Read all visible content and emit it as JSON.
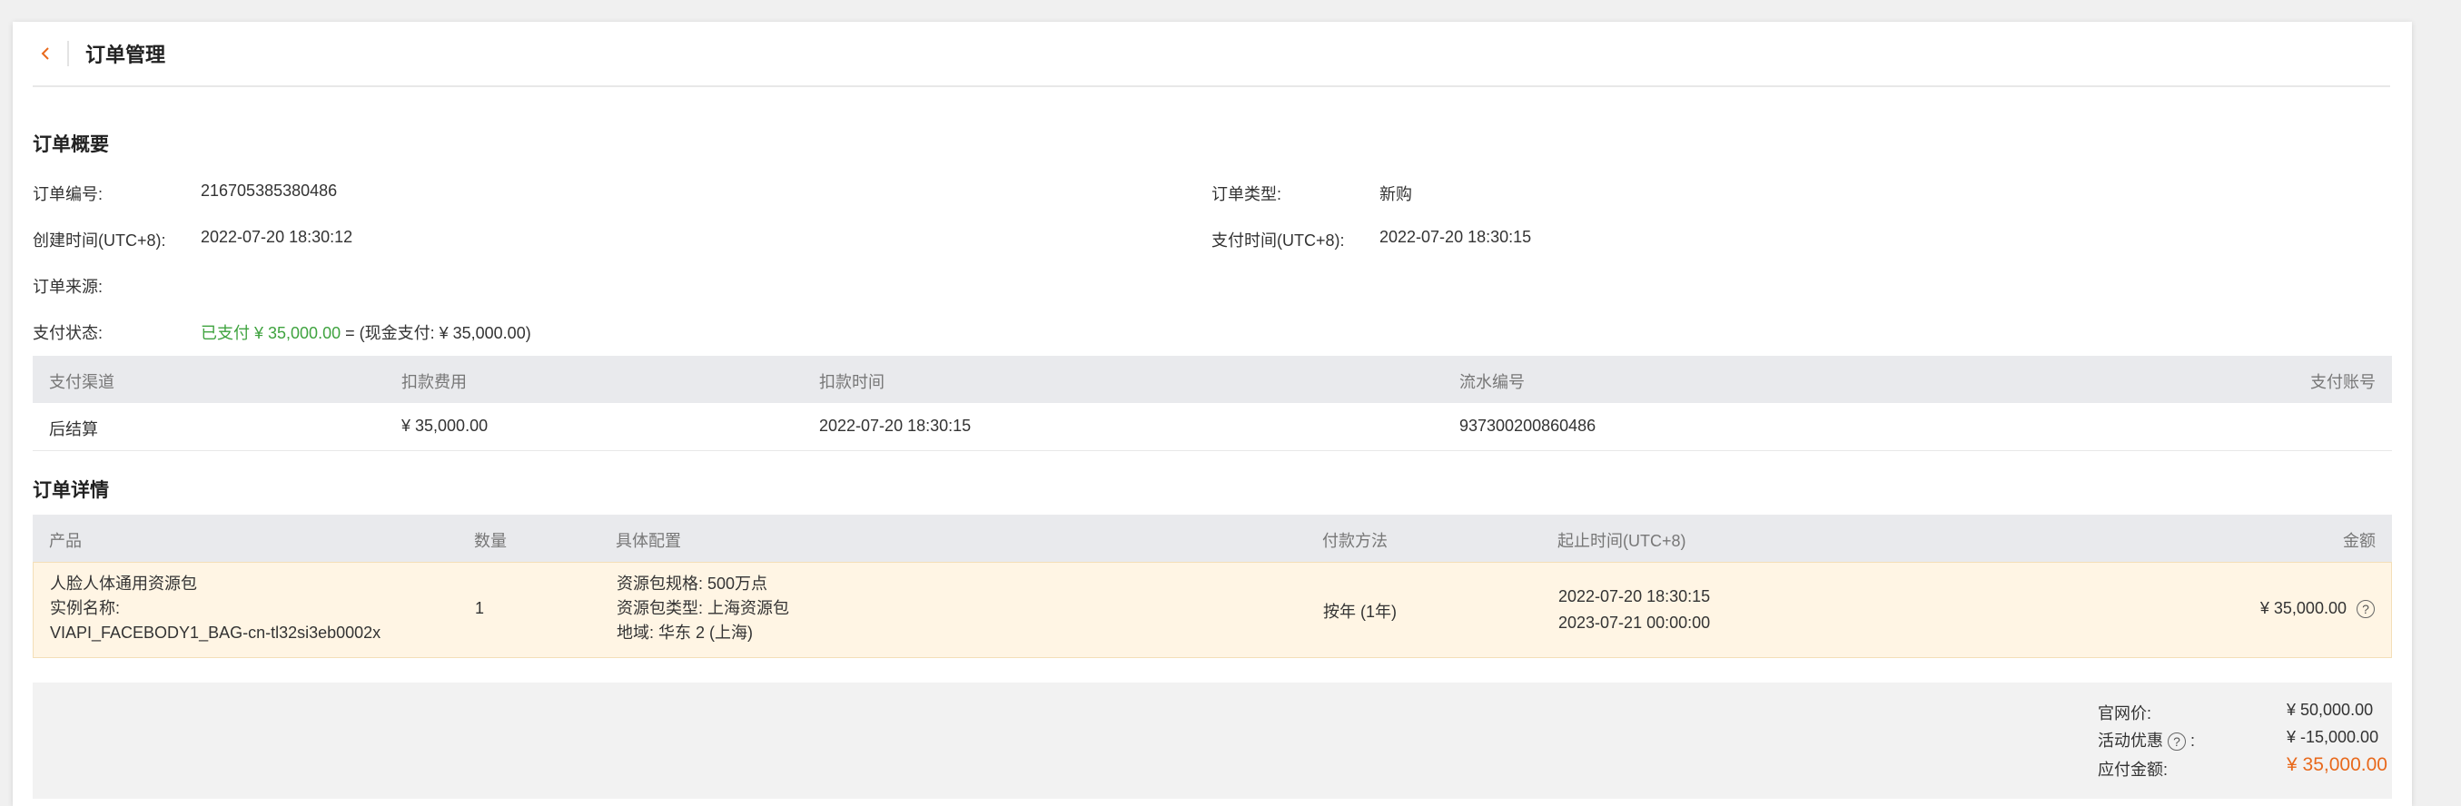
{
  "header": {
    "title": "订单管理"
  },
  "overview": {
    "title": "订单概要",
    "order_no_label": "订单编号:",
    "order_no": "216705385380486",
    "order_type_label": "订单类型:",
    "order_type": "新购",
    "created_label": "创建时间(UTC+8):",
    "created": "2022-07-20 18:30:12",
    "paid_label": "支付时间(UTC+8):",
    "paid": "2022-07-20 18:30:15",
    "source_label": "订单来源:",
    "source": "",
    "status_label": "支付状态:",
    "status_paid": "已支付 ¥ 35,000.00",
    "status_detail": "= (现金支付: ¥ 35,000.00)"
  },
  "payment_table": {
    "headers": [
      "支付渠道",
      "扣款费用",
      "扣款时间",
      "流水编号",
      "支付账号"
    ],
    "rows": [
      [
        "后结算",
        "¥ 35,000.00",
        "2022-07-20 18:30:15",
        "937300200860486",
        ""
      ]
    ]
  },
  "details": {
    "title": "订单详情",
    "headers": [
      "产品",
      "数量",
      "具体配置",
      "付款方法",
      "起止时间(UTC+8)",
      "金额"
    ],
    "row": {
      "product_name": "人脸人体通用资源包",
      "instance_label": "实例名称:",
      "instance_id": "VIAPI_FACEBODY1_BAG-cn-tl32si3eb0002x",
      "quantity": "1",
      "config": [
        "资源包规格: 500万点",
        "资源包类型: 上海资源包",
        "地域: 华东 2 (上海)"
      ],
      "pay_method": "按年 (1年)",
      "start": "2022-07-20 18:30:15",
      "end": "2023-07-21 00:00:00",
      "amount": "¥ 35,000.00"
    }
  },
  "summary": {
    "list_price_label": "官网价:",
    "list_price": "¥ 50,000.00",
    "discount_label": "活动优惠",
    "discount_colon": ":",
    "discount": "¥ -15,000.00",
    "due_label": "应付金额:",
    "due": "¥ 35,000.00"
  },
  "colors": {
    "accent": "#e8691c",
    "paid_green": "#3fa33f",
    "detail_row_bg": "#fff5e4"
  },
  "icons": {
    "back": "chevron-left-icon",
    "help": "question-circle-icon"
  }
}
